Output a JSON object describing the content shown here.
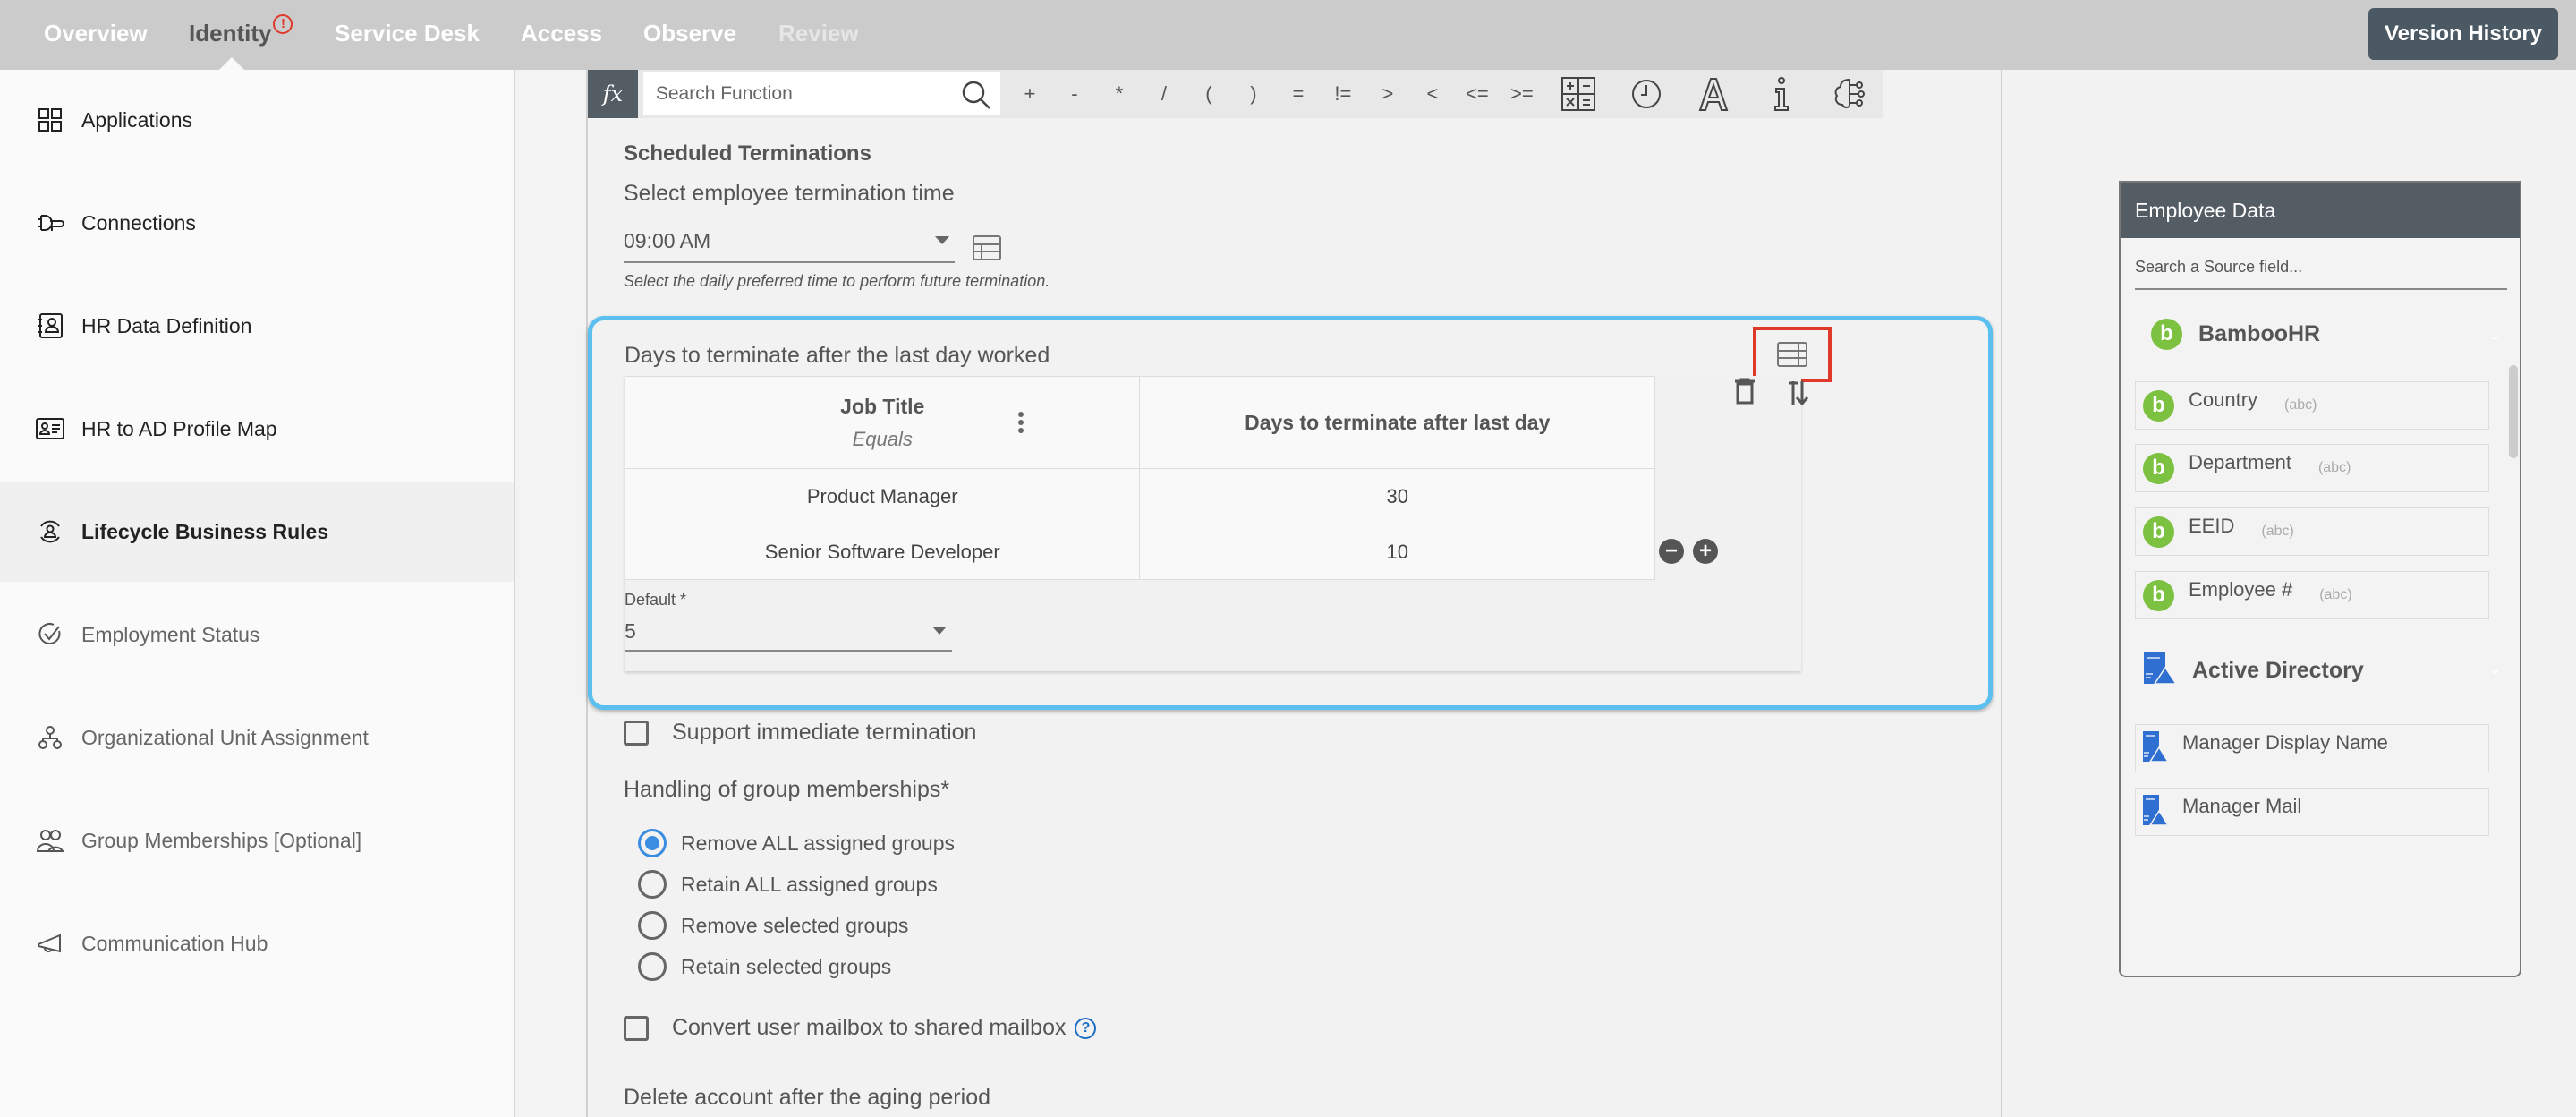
{
  "topnav": {
    "items": [
      {
        "label": "Overview",
        "state": "normal"
      },
      {
        "label": "Identity",
        "state": "active",
        "badge": "!"
      },
      {
        "label": "Service Desk",
        "state": "normal"
      },
      {
        "label": "Access",
        "state": "normal"
      },
      {
        "label": "Observe",
        "state": "normal"
      },
      {
        "label": "Review",
        "state": "disabled"
      }
    ],
    "version_history": "Version History"
  },
  "sidebar": {
    "items": [
      {
        "label": "Applications",
        "icon": "grid-icon"
      },
      {
        "label": "Connections",
        "icon": "plug-icon"
      },
      {
        "label": "HR Data Definition",
        "icon": "contact-book-icon"
      },
      {
        "label": "HR to AD Profile Map",
        "icon": "id-card-icon"
      },
      {
        "label": "Lifecycle Business Rules",
        "icon": "lifecycle-user-icon",
        "active": true
      },
      {
        "label": "Employment Status",
        "icon": "check-circle-icon"
      },
      {
        "label": "Organizational Unit Assignment",
        "icon": "org-tree-icon"
      },
      {
        "label": "Group Memberships [Optional]",
        "icon": "users-icon"
      },
      {
        "label": "Communication Hub",
        "icon": "megaphone-icon"
      }
    ]
  },
  "function_bar": {
    "fx_label": "fx",
    "search_placeholder": "Search Function",
    "operators": [
      "+",
      "-",
      "*",
      "/",
      "(",
      ")",
      "=",
      "!=",
      ">",
      "<",
      "<=",
      ">="
    ],
    "tools": [
      "calculator-icon",
      "clock-icon",
      "text-format-icon",
      "info-icon",
      "ai-brain-icon"
    ]
  },
  "scheduled": {
    "title": "Scheduled Terminations",
    "time_label": "Select employee termination time",
    "time_value": "09:00 AM",
    "hint": "Select the daily preferred time to perform future termination."
  },
  "rule": {
    "title": "Days to terminate after the last day worked",
    "columns": [
      {
        "header": "Job Title",
        "sub": "Equals"
      },
      {
        "header": "Days to terminate after last day"
      }
    ],
    "rows": [
      [
        "Product Manager",
        "30"
      ],
      [
        "Senior Software Developer",
        "10"
      ]
    ],
    "default_label": "Default *",
    "default_value": "5"
  },
  "options": {
    "immediate_termination": {
      "label": "Support immediate termination",
      "checked": false
    },
    "group_handling_label": "Handling of group memberships*",
    "group_handling": [
      {
        "label": "Remove ALL assigned groups",
        "selected": true
      },
      {
        "label": "Retain ALL assigned groups",
        "selected": false
      },
      {
        "label": "Remove selected groups",
        "selected": false
      },
      {
        "label": "Retain selected groups",
        "selected": false
      }
    ],
    "shared_mailbox": {
      "label": "Convert user mailbox to shared mailbox",
      "checked": false
    },
    "aging_label": "Delete account after the aging period"
  },
  "employee_data": {
    "title": "Employee Data",
    "search_placeholder": "Search a Source field...",
    "sources": [
      {
        "name": "BambooHR",
        "color": "#7cc140",
        "fields": [
          {
            "name": "Country",
            "type": "(abc)"
          },
          {
            "name": "Department",
            "type": "(abc)"
          },
          {
            "name": "EEID",
            "type": "(abc)"
          },
          {
            "name": "Employee #",
            "type": "(abc)"
          }
        ]
      },
      {
        "name": "Active Directory",
        "color": "#2f6fd1",
        "fields": [
          {
            "name": "Manager Display Name"
          },
          {
            "name": "Manager Mail"
          }
        ]
      }
    ]
  },
  "colors": {
    "accent_blue": "#5bc0ef",
    "highlight_red": "#e0392b",
    "radio_blue": "#3a8de0",
    "header_dark": "#545c64"
  }
}
